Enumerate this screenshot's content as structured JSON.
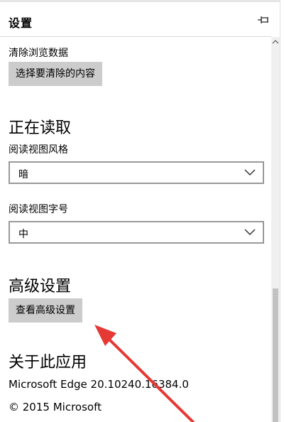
{
  "header": {
    "title": "设置"
  },
  "clear_data": {
    "label": "清除浏览数据",
    "button": "选择要清除的内容"
  },
  "reading": {
    "heading": "正在读取",
    "style_label": "阅读视图风格",
    "style_value": "暗",
    "font_label": "阅读视图字号",
    "font_value": "中"
  },
  "advanced": {
    "heading": "高级设置",
    "button": "查看高级设置"
  },
  "about": {
    "heading": "关于此应用",
    "version": "Microsoft Edge 20.10240.16384.0",
    "copyright": "© 2015 Microsoft"
  },
  "colors": {
    "button_bg": "#cccccc",
    "annotation_arrow": "#e53935"
  },
  "icons": {
    "pin": "pin-icon",
    "chevron": "chevron-down-icon",
    "scroll_up": "scroll-up-arrow-icon"
  }
}
